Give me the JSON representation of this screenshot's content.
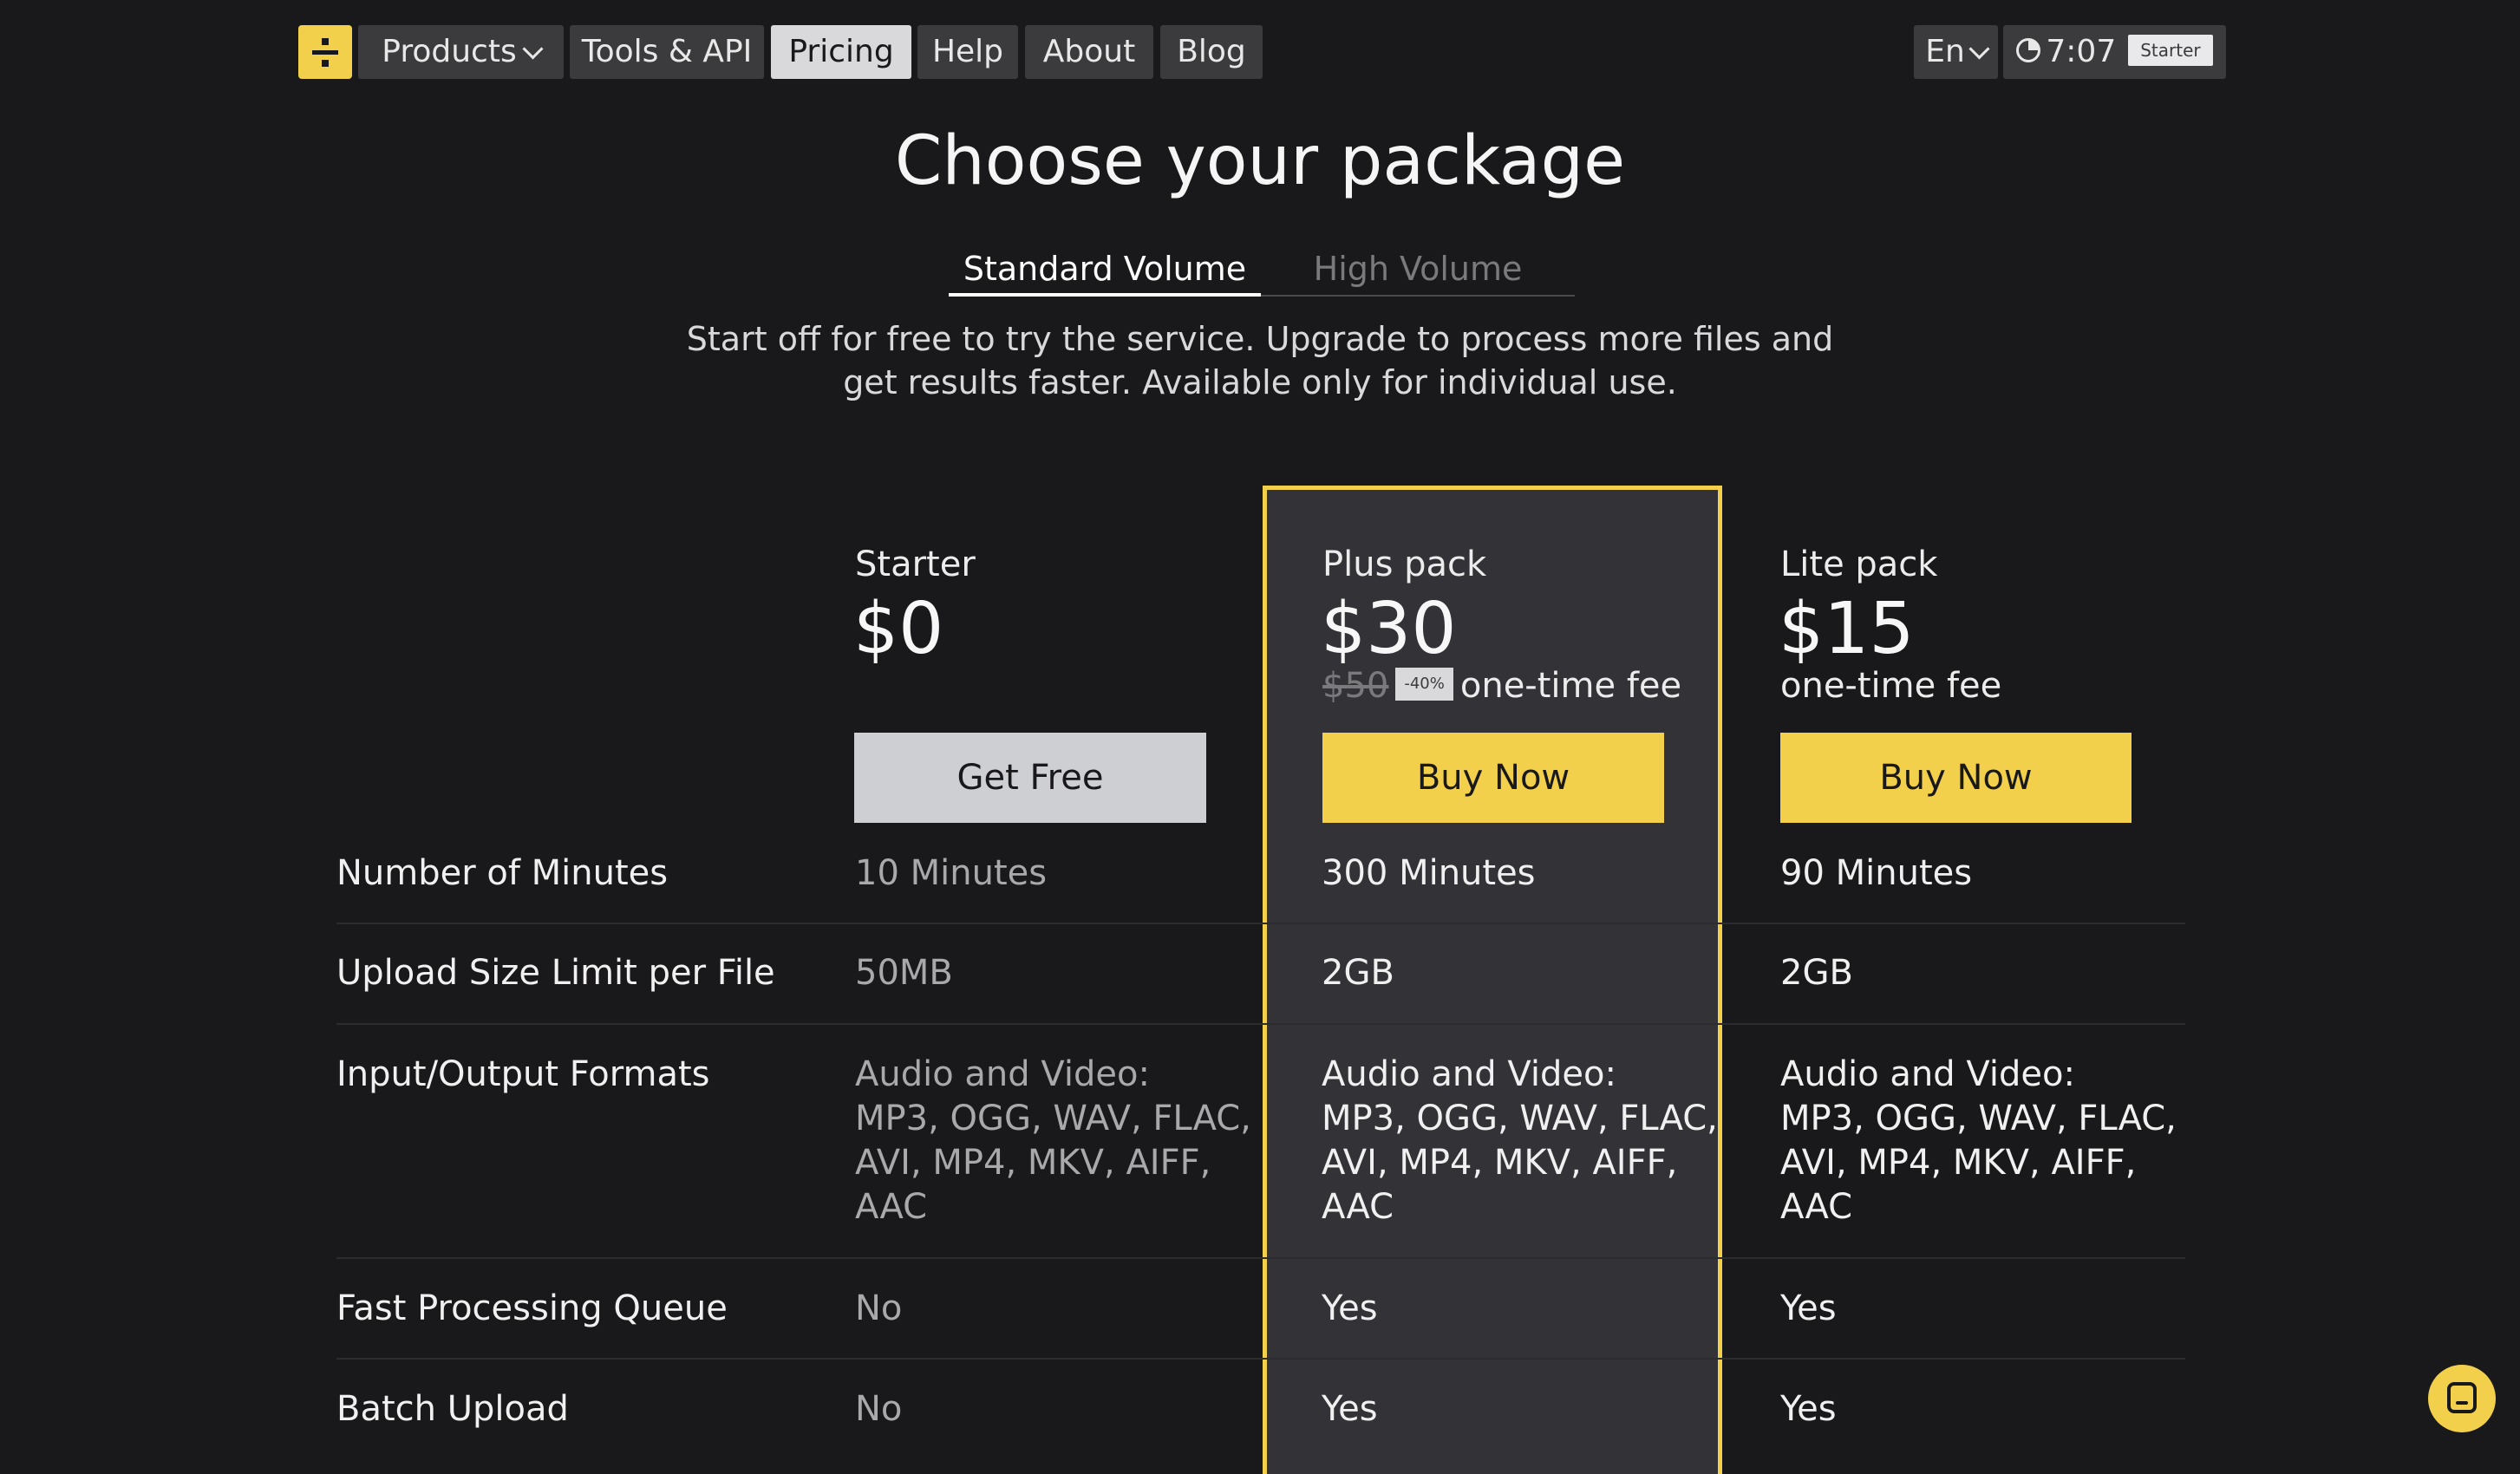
{
  "nav": {
    "items": [
      {
        "label": "Products"
      },
      {
        "label": "Tools & API"
      },
      {
        "label": "Pricing"
      },
      {
        "label": "Help"
      },
      {
        "label": "About"
      },
      {
        "label": "Blog"
      }
    ],
    "language": "En",
    "time": "7:07",
    "plan_badge": "Starter"
  },
  "page": {
    "title": "Choose your package",
    "tabs": [
      "Standard Volume",
      "High Volume"
    ],
    "subtitle_line1": "Start off for free to try the service. Upgrade to process more files and",
    "subtitle_line2": "get results faster. Available only for individual use."
  },
  "plans": [
    {
      "name": "Starter",
      "price": "$0",
      "cta": "Get Free"
    },
    {
      "name": "Plus pack",
      "price": "$30",
      "old_price": "$50",
      "discount": "-40%",
      "fee": "one-time fee",
      "cta": "Buy Now"
    },
    {
      "name": "Lite pack",
      "price": "$15",
      "fee": "one-time fee",
      "cta": "Buy Now"
    }
  ],
  "features": [
    {
      "label": "Number of Minutes",
      "values": [
        "10 Minutes",
        "300 Minutes",
        "90 Minutes"
      ]
    },
    {
      "label": "Upload Size Limit per File",
      "values": [
        "50MB",
        "2GB",
        "2GB"
      ]
    },
    {
      "label": "Input/Output Formats",
      "values": [
        [
          "Audio and Video:",
          "MP3, OGG, WAV, FLAC,",
          "AVI, MP4, MKV, AIFF,",
          "AAC"
        ],
        [
          "Audio and Video:",
          "MP3, OGG, WAV, FLAC,",
          "AVI, MP4, MKV, AIFF,",
          "AAC"
        ],
        [
          "Audio and Video:",
          "MP3, OGG, WAV, FLAC,",
          "AVI, MP4, MKV, AIFF,",
          "AAC"
        ]
      ]
    },
    {
      "label": "Fast Processing Queue",
      "values": [
        "No",
        "Yes",
        "Yes"
      ]
    },
    {
      "label": "Batch Upload",
      "values": [
        "No",
        "Yes",
        "Yes"
      ]
    }
  ],
  "colors": {
    "accent": "#f2d04b",
    "background": "#19181a",
    "card": "#333236"
  },
  "icons": {
    "chat": "chat-icon",
    "clock": "clock-icon",
    "logo": "divide-logo"
  }
}
